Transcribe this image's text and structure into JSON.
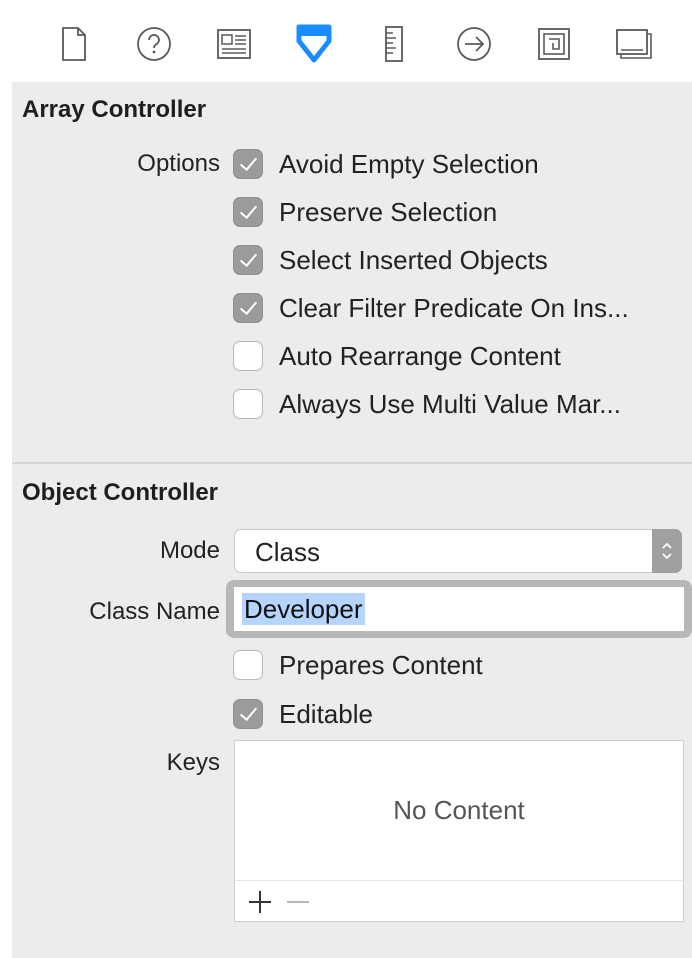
{
  "toolbar": {
    "icons": [
      {
        "name": "file-inspector-icon",
        "selected": false
      },
      {
        "name": "quick-help-icon",
        "selected": false
      },
      {
        "name": "identity-inspector-icon",
        "selected": false
      },
      {
        "name": "attributes-inspector-icon",
        "selected": true
      },
      {
        "name": "size-inspector-icon",
        "selected": false
      },
      {
        "name": "connections-inspector-icon",
        "selected": false
      },
      {
        "name": "bindings-inspector-icon",
        "selected": false
      },
      {
        "name": "view-effects-inspector-icon",
        "selected": false
      }
    ],
    "accent_color": "#1a8cff",
    "icon_color": "#5a5a5a"
  },
  "array_controller": {
    "title": "Array Controller",
    "options_label": "Options",
    "options": [
      {
        "label": "Avoid Empty Selection",
        "checked": true
      },
      {
        "label": "Preserve Selection",
        "checked": true
      },
      {
        "label": "Select Inserted Objects",
        "checked": true
      },
      {
        "label": "Clear Filter Predicate On Ins...",
        "checked": true
      },
      {
        "label": "Auto Rearrange Content",
        "checked": false
      },
      {
        "label": "Always Use Multi Value Mar...",
        "checked": false
      }
    ]
  },
  "object_controller": {
    "title": "Object Controller",
    "mode_label": "Mode",
    "mode_value": "Class",
    "class_name_label": "Class Name",
    "class_name_value": "Developer",
    "prepares_content": {
      "label": "Prepares Content",
      "checked": false
    },
    "editable": {
      "label": "Editable",
      "checked": true
    },
    "keys_label": "Keys",
    "keys_empty_text": "No Content",
    "add_symbol": "+",
    "remove_symbol": "−"
  }
}
